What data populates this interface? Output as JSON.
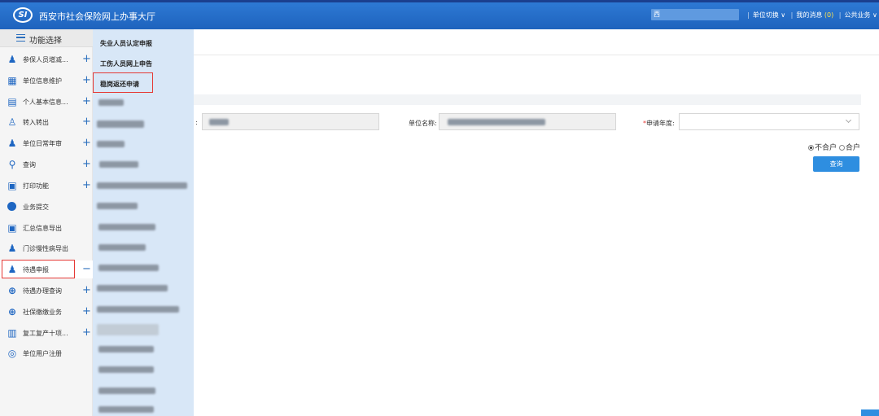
{
  "header": {
    "logo_text": "SI",
    "title": "西安市社会保险网上办事大厅",
    "user_name": "西",
    "links": [
      "单位切换",
      "我的消息",
      "公共业务"
    ],
    "message_count": "(0)"
  },
  "sidebar": {
    "function_select_label": "功能选择",
    "items": [
      {
        "label": "参保人员增减...",
        "toggle": "+",
        "icon": "person-icon"
      },
      {
        "label": "单位信息维护",
        "toggle": "+",
        "icon": "building-icon"
      },
      {
        "label": "个人基本信息...",
        "toggle": "+",
        "icon": "person-card-icon"
      },
      {
        "label": "转入转出",
        "toggle": "+",
        "icon": "person-add-icon"
      },
      {
        "label": "单位日常年审",
        "toggle": "+",
        "icon": "people-icon"
      },
      {
        "label": "查询",
        "toggle": "+",
        "icon": "search-icon"
      },
      {
        "label": "打印功能",
        "toggle": "+",
        "icon": "printer-icon"
      },
      {
        "label": "业务提交",
        "toggle": "",
        "icon": "check-circle-icon"
      },
      {
        "label": "汇总信息导出",
        "toggle": "",
        "icon": "printer-icon"
      },
      {
        "label": "门诊慢性病导出",
        "toggle": "",
        "icon": "person-icon"
      },
      {
        "label": "待遇申报",
        "toggle": "−",
        "icon": "person-icon"
      },
      {
        "label": "待遇办理查询",
        "toggle": "+",
        "icon": "search-circle-icon"
      },
      {
        "label": "社保缴缴业务",
        "toggle": "+",
        "icon": "search-circle-icon"
      },
      {
        "label": "复工复产十项...",
        "toggle": "+",
        "icon": "document-icon"
      },
      {
        "label": "单位用户注册",
        "toggle": "",
        "icon": "logo-icon"
      }
    ]
  },
  "submenu": {
    "items": [
      "失业人员认定申报",
      "工伤人员网上申告",
      "稳岗返还申请"
    ]
  },
  "form": {
    "field1_label": ":",
    "field2_label": "单位名称:",
    "year_label": "申请年度:",
    "required_mark": "*",
    "radio_options": [
      "不合户",
      "合户"
    ],
    "query_button": "查询"
  }
}
